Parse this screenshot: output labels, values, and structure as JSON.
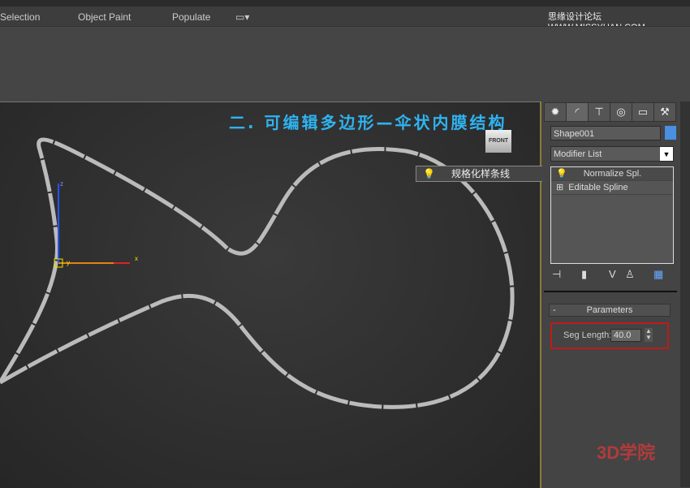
{
  "ribbon": {
    "items": [
      "Selection",
      "Object Paint",
      "Populate"
    ]
  },
  "watermark": "思缘设计论坛 WWW.MISSYUAN.COM",
  "viewport": {
    "title": "二. 可编辑多边形—伞状内膜结构",
    "viewcube_label": "FRONT",
    "axes": {
      "x": "x",
      "y": "y",
      "z": "z"
    },
    "tooltip": "规格化样条线"
  },
  "panel": {
    "tabs": [
      "create-icon",
      "modify-icon",
      "hierarchy-icon",
      "motion-icon",
      "display-icon",
      "utilities-icon"
    ],
    "object_name": "Shape001",
    "object_color": "#4a8fe0",
    "modifier_list": "Modifier List",
    "stack": [
      "Normalize Spl.",
      "Editable Spline"
    ],
    "rollout": {
      "collapse": "-",
      "title": "Parameters"
    },
    "seg_length_label": "Seg Length:",
    "seg_length_value": "40.0"
  },
  "brand_watermark": "3D学院",
  "colors": {
    "title": "#2fb3f0",
    "highlight": "#c01a1a"
  }
}
